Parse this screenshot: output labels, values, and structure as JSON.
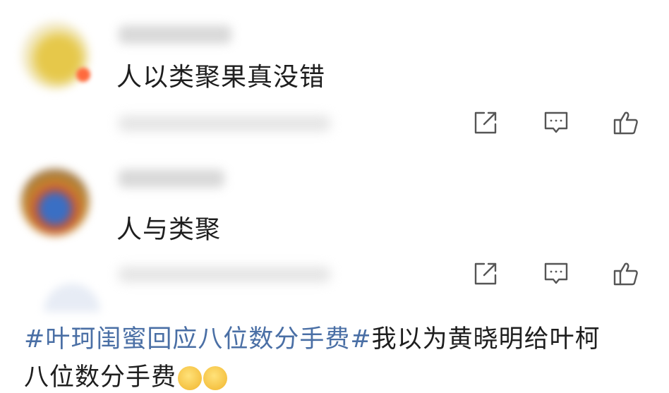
{
  "comments": [
    {
      "text": "人以类聚果真没错",
      "actions": {
        "share": "share-icon",
        "reply": "comment-icon",
        "like": "thumbs-up-icon"
      }
    },
    {
      "text": "人与类聚",
      "actions": {
        "share": "share-icon",
        "reply": "comment-icon",
        "like": "thumbs-up-icon"
      }
    }
  ],
  "headline": {
    "hashtag": "#叶珂闺蜜回应八位数分手费#",
    "text": "我以为黄晓明给叶柯",
    "line2": "八位数分手费"
  },
  "colors": {
    "hashtag": "#4a6fa5",
    "icon_stroke": "#555555"
  }
}
